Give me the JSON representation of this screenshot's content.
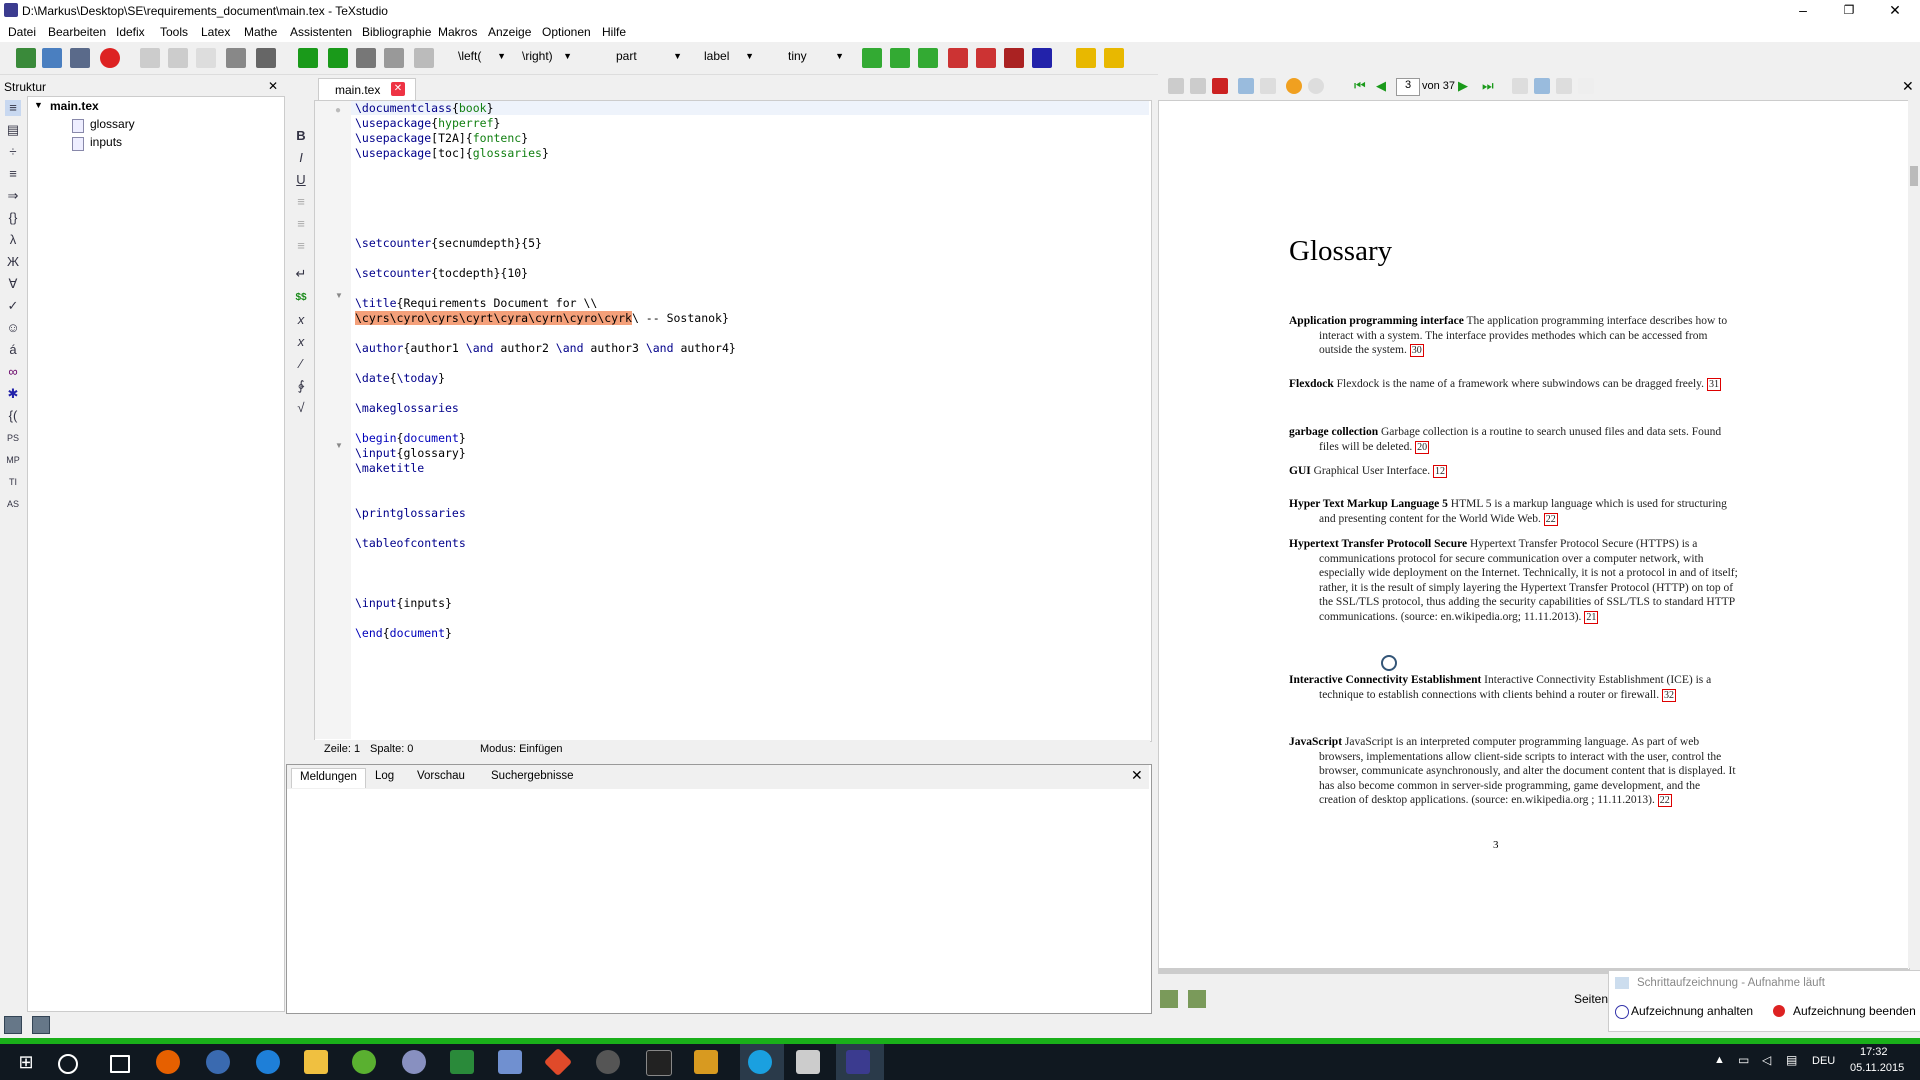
{
  "window": {
    "title": "D:\\Markus\\Desktop\\SE\\requirements_document\\main.tex - TeXstudio",
    "minimize": "–",
    "maximize": "❐",
    "close": "✕"
  },
  "menu": [
    "Datei",
    "Bearbeiten",
    "Idefix",
    "Tools",
    "Latex",
    "Mathe",
    "Assistenten",
    "Bibliographie",
    "Makros",
    "Anzeige",
    "Optionen",
    "Hilfe"
  ],
  "toolbar": {
    "left_select": "\\left(",
    "right_select": "\\right)",
    "section_select": "part",
    "label_select": "label",
    "size_select": "tiny"
  },
  "structure": {
    "header": "Struktur",
    "close": "✕",
    "root": "main.tex",
    "children": [
      "glossary",
      "inputs"
    ]
  },
  "editor": {
    "tab_label": "main.tex",
    "tab_close": "✕",
    "status": {
      "line": "Zeile: 1",
      "column": "Spalte: 0",
      "mode": "Modus: Einfügen"
    }
  },
  "messages": {
    "tabs": [
      "Meldungen",
      "Log",
      "Vorschau",
      "Suchergebnisse"
    ],
    "close": "✕"
  },
  "pdf": {
    "page_input": "3",
    "page_of": "von 37",
    "heading": "Glossary",
    "page_number": "3",
    "entries": [
      {
        "term": "Application programming interface",
        "text": "The application programming interface describes how to interact with a system.  The interface provides methodes which can be accessed from outside the system.",
        "ref": "30"
      },
      {
        "term": "Flexdock",
        "text": "Flexdock is the name of a framework where subwindows can be dragged freely.",
        "ref": "31"
      },
      {
        "term": "garbage collection",
        "text": "Garbage collection is a routine to search unused files and data sets. Found files will be deleted.",
        "ref": "20"
      },
      {
        "term": "GUI",
        "text": "Graphical User Interface.",
        "ref": "12"
      },
      {
        "term": "Hyper Text Markup Language 5",
        "text": "HTML 5 is a markup language which is used for structuring and presenting content for the World Wide Web.",
        "ref": "22"
      },
      {
        "term": "Hypertext Transfer Protocoll Secure",
        "text": "Hypertext Transfer Protocol Secure (HTTPS) is a communications protocol for secure communication over a computer network, with especially wide deployment on the Internet. Technically, it is not a protocol in and of itself; rather, it is the result of simply layering the Hypertext Transfer Protocol (HTTP) on top of the SSL/TLS protocol, thus adding the security capabilities of SSL/TLS to standard HTTP communications. (source: en.wikipedia.org; 11.11.2013).",
        "ref": "21"
      },
      {
        "term": "Interactive Connectivity Establishment",
        "text": "Interactive Connectivity Establishment (ICE) is a technique to establish connections with clients behind a router or firewall.",
        "ref": "32"
      },
      {
        "term": "JavaScript",
        "text": "JavaScript is an interpreted computer programming language. As part of web browsers, implementations allow client-side scripts to interact with the user, control the browser, communicate asynchronously, and alter the document content that is displayed. It has also become common in server-side programming, game development, and the creation of desktop applications. (source: en.wikipedia.org ; 11.11.2013).",
        "ref": "22"
      }
    ]
  },
  "recording": {
    "title": "Schrittaufzeichnung - Aufnahme läuft",
    "pause": "Aufzeichnung anhalten",
    "stop": "Aufzeichnung beenden",
    "seiten": "Seiten"
  },
  "taskbar": {
    "lang": "DEU",
    "time": "17:32",
    "date": "05.11.2015"
  }
}
